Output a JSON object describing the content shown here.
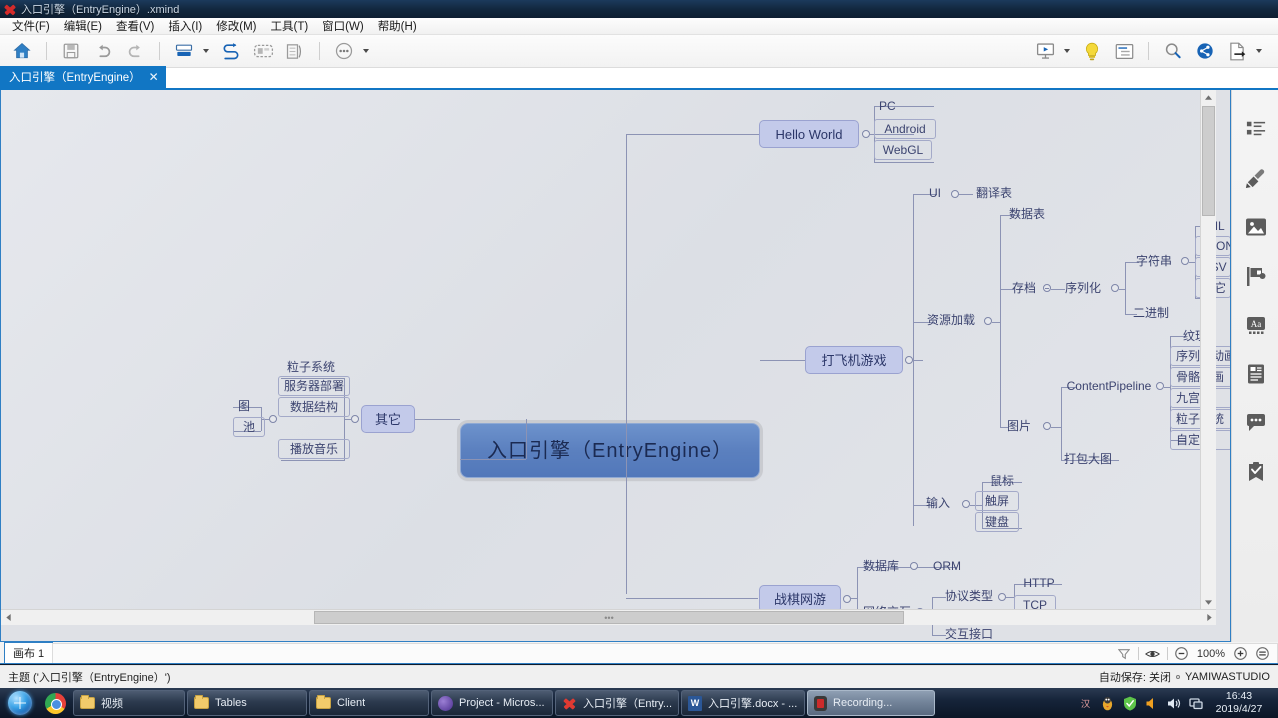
{
  "window": {
    "title": "入口引擎（EntryEngine）.xmind",
    "app_icon": "xmind-icon"
  },
  "menubar": {
    "items": [
      {
        "label": "文件(F)",
        "name": "menu-file"
      },
      {
        "label": "编辑(E)",
        "name": "menu-edit"
      },
      {
        "label": "查看(V)",
        "name": "menu-view"
      },
      {
        "label": "插入(I)",
        "name": "menu-insert"
      },
      {
        "label": "修改(M)",
        "name": "menu-modify"
      },
      {
        "label": "工具(T)",
        "name": "menu-tools"
      },
      {
        "label": "窗口(W)",
        "name": "menu-window"
      },
      {
        "label": "帮助(H)",
        "name": "menu-help"
      }
    ]
  },
  "toolbar": {
    "left_buttons": [
      {
        "icon": "home-icon",
        "name": "home-button"
      },
      {
        "icon": "save-icon",
        "name": "save-button"
      },
      {
        "icon": "undo-icon",
        "name": "undo-button"
      },
      {
        "icon": "redo-icon",
        "name": "redo-button"
      },
      {
        "icon": "topic-icon",
        "name": "insert-topic-button"
      },
      {
        "icon": "relationship-icon",
        "name": "relationship-button"
      },
      {
        "icon": "boundary-icon",
        "name": "boundary-button"
      },
      {
        "icon": "summary-icon",
        "name": "summary-button"
      },
      {
        "icon": "more-icon",
        "name": "more-button"
      }
    ],
    "right_buttons": [
      {
        "icon": "presentation-icon",
        "name": "presentation-button"
      },
      {
        "icon": "brainstorm-icon",
        "name": "brainstorm-button"
      },
      {
        "icon": "outline-icon",
        "name": "outline-button"
      },
      {
        "icon": "search-icon",
        "name": "search-button"
      },
      {
        "icon": "share-icon",
        "name": "share-button"
      },
      {
        "icon": "export-icon",
        "name": "export-button"
      }
    ]
  },
  "tabs": [
    {
      "label": "入口引擎（EntryEngine）",
      "close": "✕",
      "active": true
    }
  ],
  "mindmap": {
    "root": {
      "label": "入口引擎（EntryEngine）"
    },
    "branches": {
      "hello_world": {
        "label": "Hello World",
        "children": [
          "PC",
          "Android",
          "WebGL"
        ]
      },
      "plane_game": {
        "label": "打飞机游戏",
        "children": [
          {
            "label": "UI",
            "children": [
              "翻译表"
            ]
          },
          {
            "label": "资源加载",
            "children": [
              {
                "label": "数据表"
              },
              {
                "label": "存档",
                "children": [
                  {
                    "label": "序列化",
                    "children": [
                      {
                        "label": "字符串",
                        "children": [
                          "XML",
                          "JSON",
                          "CSV",
                          "其它"
                        ]
                      },
                      {
                        "label": "二进制"
                      }
                    ]
                  }
                ]
              },
              {
                "label": "图片",
                "children": [
                  {
                    "label": "ContentPipeline",
                    "children": [
                      "纹理",
                      "序列帧动画",
                      "骨骼动画",
                      "九宫格",
                      "粒子系统",
                      "自定义"
                    ]
                  },
                  {
                    "label": "打包大图"
                  }
                ]
              }
            ]
          },
          {
            "label": "输入",
            "children": [
              "鼠标",
              "触屏",
              "键盘"
            ]
          }
        ]
      },
      "war_chess": {
        "label": "战棋网游",
        "children": [
          {
            "label": "数据库",
            "children": [
              "ORM"
            ]
          },
          {
            "label": "网络交互",
            "children": [
              {
                "label": "协议类型",
                "children": [
                  "HTTP",
                  "TCP"
                ]
              },
              {
                "label": "交互接口"
              }
            ]
          }
        ]
      },
      "others": {
        "label": "其它",
        "children": [
          {
            "label": "粒子系统"
          },
          {
            "label": "服务器部署"
          },
          {
            "label": "数据结构",
            "children": [
              "图",
              "池"
            ]
          },
          {
            "label": "播放音乐"
          }
        ]
      }
    }
  },
  "right_sidebar": {
    "items": [
      {
        "icon": "outline-list-icon",
        "name": "sidebar-outline"
      },
      {
        "icon": "brush-icon",
        "name": "sidebar-style"
      },
      {
        "icon": "image-icon",
        "name": "sidebar-image"
      },
      {
        "icon": "marker-flag-icon",
        "name": "sidebar-marker"
      },
      {
        "icon": "font-icon",
        "name": "sidebar-font"
      },
      {
        "icon": "notes-icon",
        "name": "sidebar-notes"
      },
      {
        "icon": "comment-icon",
        "name": "sidebar-comment"
      },
      {
        "icon": "task-clipboard-icon",
        "name": "sidebar-task"
      }
    ]
  },
  "sheet_bar": {
    "sheet_name": "画布 1",
    "controls": {
      "filter_icon": "filter-icon",
      "eye_icon": "eye-icon",
      "zoom_out": "−",
      "zoom_level": "100%",
      "zoom_in": "+",
      "fit_icon": "fit-icon"
    }
  },
  "statusbar": {
    "left": "主题 ('入口引擎（EntryEngine）')",
    "autosave": "自动保存: 关闭",
    "studio": "YAMIWASTUDIO"
  },
  "taskbar": {
    "start": "start-orb",
    "quicklaunch": [
      {
        "icon": "chrome-icon",
        "name": "chrome-launch"
      }
    ],
    "buttons": [
      {
        "label": "视频",
        "icon": "folder-icon",
        "name": "task-video",
        "active": false
      },
      {
        "label": "Tables",
        "icon": "folder-icon",
        "name": "task-tables",
        "active": false
      },
      {
        "label": "Client",
        "icon": "folder-icon",
        "name": "task-client",
        "active": false
      },
      {
        "label": "Project - Micros...",
        "icon": "project-icon",
        "name": "task-project",
        "active": false
      },
      {
        "label": "入口引擎（Entry...",
        "icon": "xmind-icon",
        "name": "task-xmind",
        "active": false
      },
      {
        "label": "入口引擎.docx - ...",
        "icon": "word-icon",
        "name": "task-word",
        "active": false
      },
      {
        "label": "Recording...",
        "icon": "recorder-icon",
        "name": "task-recording",
        "active": true
      }
    ],
    "tray": [
      "ime-icon",
      "penguin-icon",
      "shield-icon",
      "volume-mute-icon",
      "speaker-icon",
      "network-icon"
    ],
    "clock": {
      "time": "16:43",
      "date": "2019/4/27"
    }
  }
}
